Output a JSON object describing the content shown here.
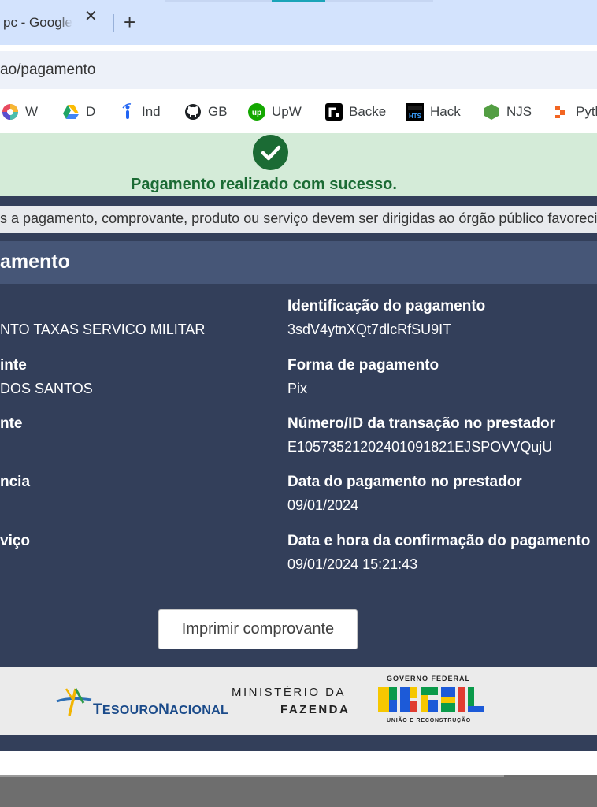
{
  "browser": {
    "tab_title": "pc - Google",
    "tab_close": "✕",
    "new_tab": "+",
    "url": "ao/pagamento"
  },
  "bookmarks": [
    {
      "label": "W",
      "icon": "color-wheel-icon"
    },
    {
      "label": "D",
      "icon": "google-drive-icon"
    },
    {
      "label": "Ind",
      "icon": "indeed-icon"
    },
    {
      "label": "GB",
      "icon": "github-icon"
    },
    {
      "label": "UpW",
      "icon": "upwork-icon"
    },
    {
      "label": "Backe",
      "icon": "backend-icon"
    },
    {
      "label": "Hack",
      "icon": "hts-icon"
    },
    {
      "label": "NJS",
      "icon": "nodejs-icon"
    },
    {
      "label": "Pyth",
      "icon": "python-icon"
    }
  ],
  "banner": {
    "success_text": "Pagamento realizado com sucesso."
  },
  "notice": "s a pagamento, comprovante, produto ou serviço devem ser dirigidas ao órgão público favorecido.",
  "panel": {
    "title": "amento",
    "left_fields": [
      {
        "label": "",
        "value": "NTO TAXAS SERVICO MILITAR"
      },
      {
        "label": "inte",
        "value": "DOS SANTOS"
      },
      {
        "label": "nte",
        "value": ""
      },
      {
        "label": "ncia",
        "value": ""
      },
      {
        "label": "viço",
        "value": ""
      }
    ],
    "right_fields": [
      {
        "label": "Identificação do pagamento",
        "value": "3sdV4ytnXQt7dlcRfSU9IT"
      },
      {
        "label": "Forma de pagamento",
        "value": "Pix"
      },
      {
        "label": "Número/ID da transação no prestador",
        "value": "E10573521202401091821EJSPOVVQujU"
      },
      {
        "label": "Data do pagamento no prestador",
        "value": "09/01/2024"
      },
      {
        "label": "Data e hora da confirmação do pagamento",
        "value": "09/01/2024 15:21:43"
      }
    ],
    "print_button": "Imprimir comprovante"
  },
  "footer": {
    "tesouro_a": "T",
    "tesouro_b": "ESOURO",
    "tesouro_c": "N",
    "tesouro_d": "ACIONAL",
    "ministerio_line1": "MINISTÉRIO DA",
    "ministerio_line2": "FAZENDA",
    "gov_line1": "GOVERNO FEDERAL",
    "gov_line2": "UNIÃO E RECONSTRUÇÃO",
    "brasil_word": "BRASIL"
  },
  "colors": {
    "panel_bg": "#333f5a",
    "panel_header": "#465677",
    "success_bg": "#d4ebd8",
    "success_text": "#1b6b34"
  }
}
